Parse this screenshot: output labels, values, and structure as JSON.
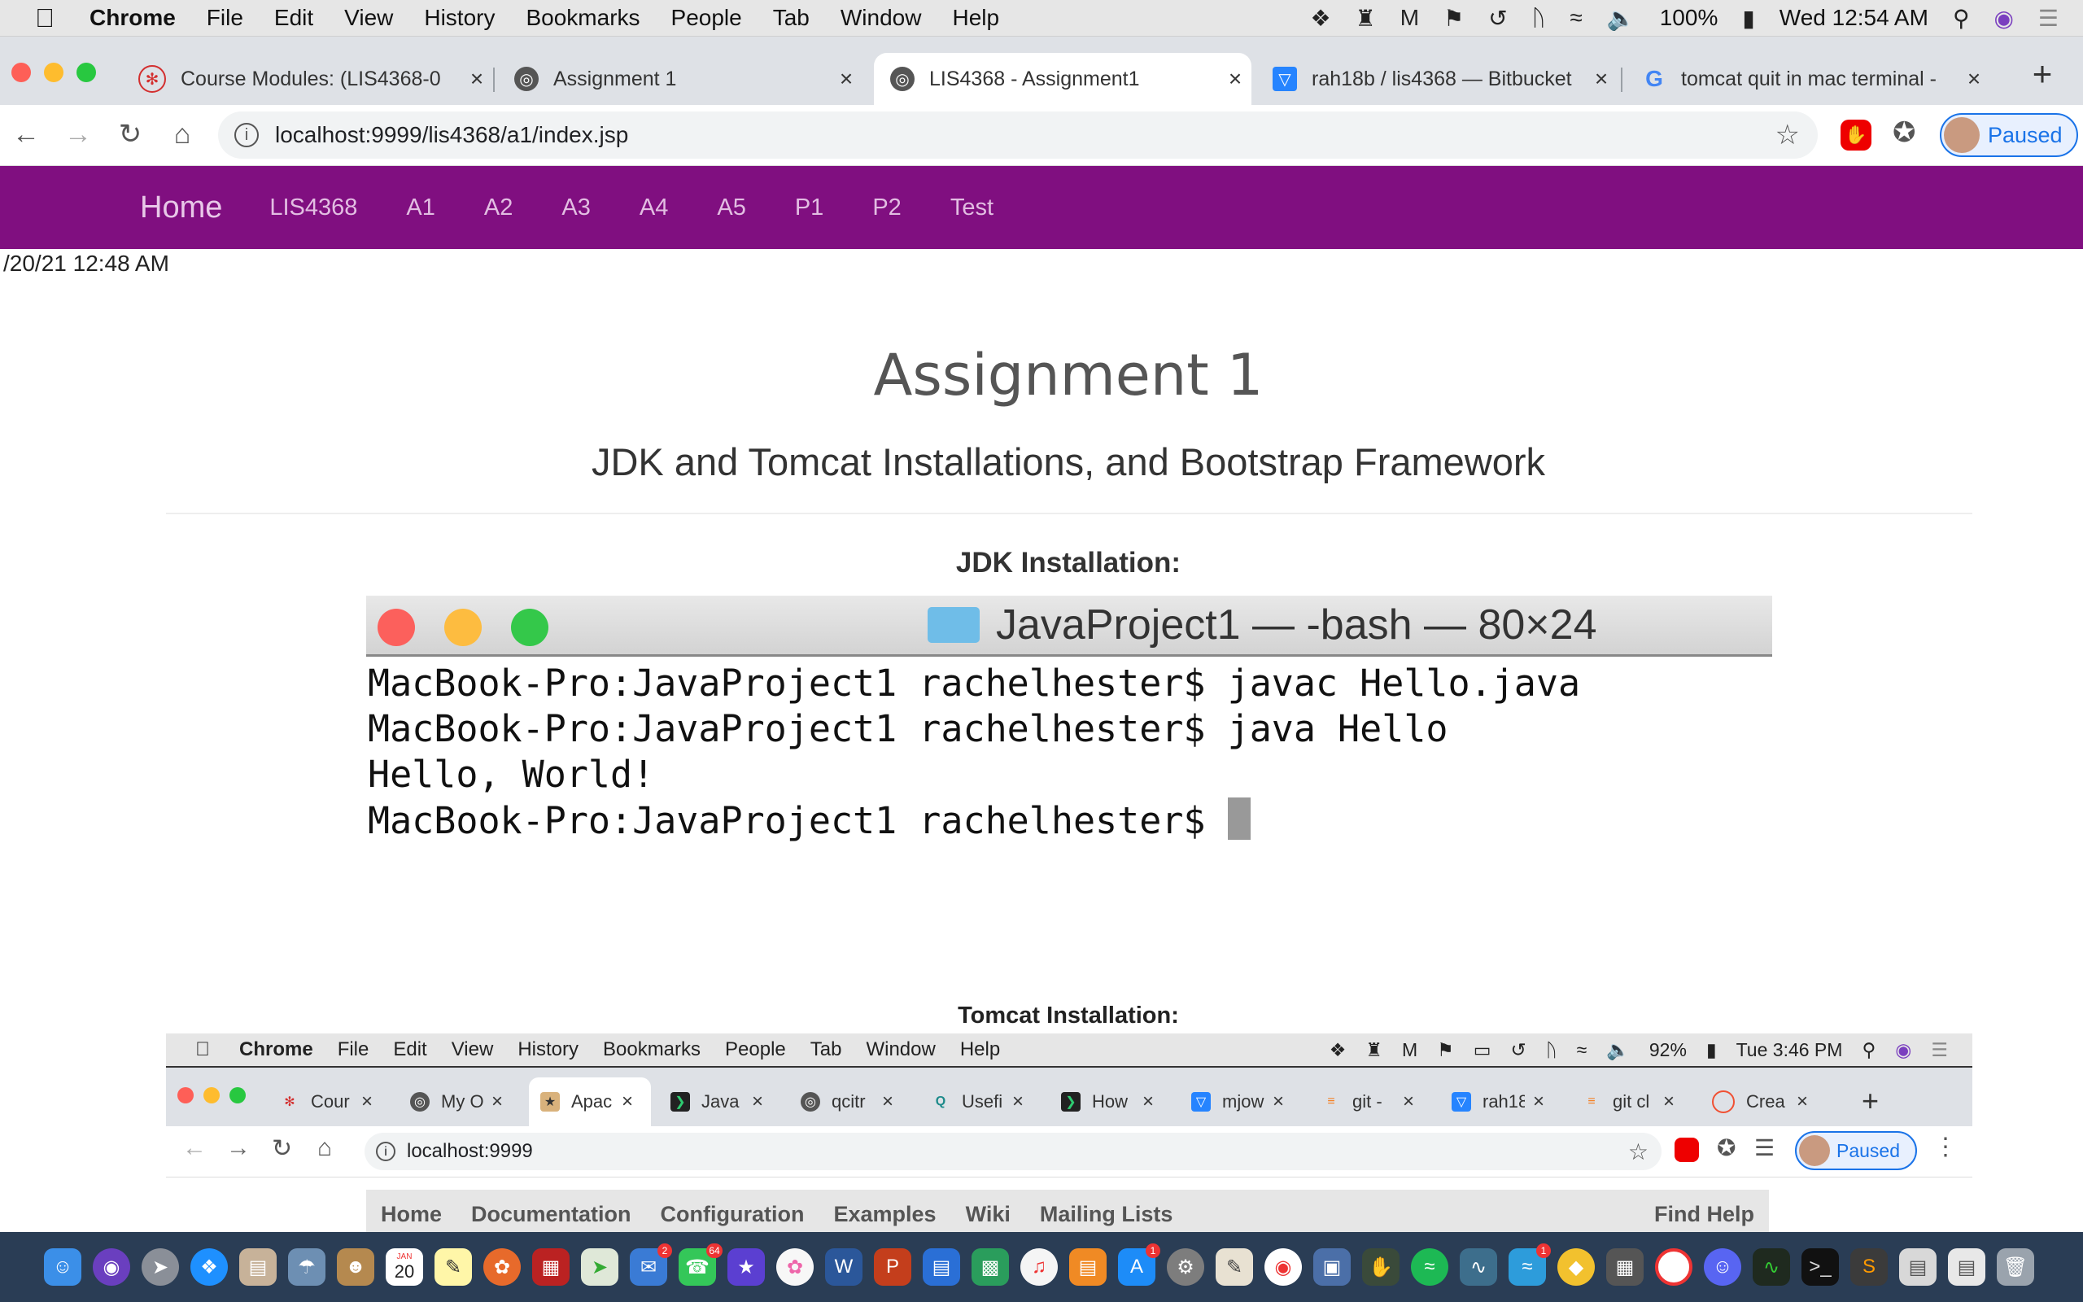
{
  "menubar": {
    "items": [
      "Chrome",
      "File",
      "Edit",
      "View",
      "History",
      "Bookmarks",
      "People",
      "Tab",
      "Window",
      "Help"
    ],
    "battery": "100%",
    "clock": "Wed 12:54 AM"
  },
  "tabs": [
    {
      "title": "Course Modules: (LIS4368-0",
      "favicon": "canvas-icon"
    },
    {
      "title": "Assignment 1",
      "favicon": "globe-icon"
    },
    {
      "title": "LIS4368 - Assignment1",
      "favicon": "globe-icon"
    },
    {
      "title": "rah18b / lis4368 — Bitbucket",
      "favicon": "bitbucket-icon"
    },
    {
      "title": "tomcat quit in mac terminal -",
      "favicon": "google-icon"
    }
  ],
  "toolbar": {
    "url": "localhost:9999/lis4368/a1/index.jsp",
    "profile_label": "Paused"
  },
  "site_nav": {
    "brand": "Home",
    "links": [
      "LIS4368",
      "A1",
      "A2",
      "A3",
      "A4",
      "A5",
      "P1",
      "P2",
      "Test"
    ]
  },
  "page": {
    "datetime": "/20/21 12:48 AM",
    "title": "Assignment 1",
    "subtitle": "JDK and Tomcat Installations, and Bootstrap Framework",
    "jdk_label": "JDK Installation:",
    "tomcat_label": "Tomcat Installation:"
  },
  "terminal": {
    "title": "JavaProject1 — -bash — 80×24",
    "lines": [
      "MacBook-Pro:JavaProject1 rachelhester$ javac Hello.java",
      "MacBook-Pro:JavaProject1 rachelhester$ java Hello",
      "Hello, World!",
      "MacBook-Pro:JavaProject1 rachelhester$ "
    ]
  },
  "nested": {
    "menubar": {
      "items": [
        "Chrome",
        "File",
        "Edit",
        "View",
        "History",
        "Bookmarks",
        "People",
        "Tab",
        "Window",
        "Help"
      ],
      "battery": "92%",
      "clock": "Tue 3:46 PM"
    },
    "tabs": [
      "Cour",
      "My O",
      "Apac",
      "Java",
      "qcitr",
      "Usefi",
      "How",
      "mjow",
      "git - ",
      "rah18",
      "git cl",
      "Crea"
    ],
    "url": "localhost:9999",
    "profile_label": "Paused",
    "tomcat_nav": [
      "Home",
      "Documentation",
      "Configuration",
      "Examples",
      "Wiki",
      "Mailing Lists"
    ],
    "find_help": "Find Help"
  },
  "dock": {
    "calendar_month": "JAN",
    "calendar_day": "20",
    "badges": {
      "messages": "2",
      "facetime": "64",
      "appstore": "1",
      "mysql": "1"
    }
  },
  "colors": {
    "site_nav_bg": "#800f80",
    "chrome_tabstrip": "#dee1e6",
    "profile_blue": "#1a73e8"
  }
}
